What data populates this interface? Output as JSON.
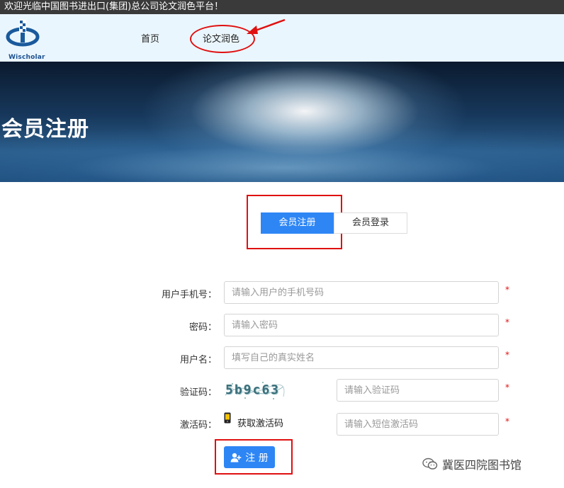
{
  "topbar": {
    "welcome": "欢迎光临中国图书进出口(集团)总公司论文润色平台！"
  },
  "header": {
    "logo_text": "Wischolar",
    "nav": [
      {
        "label": "首页"
      },
      {
        "label": "论文润色"
      }
    ]
  },
  "banner": {
    "title": "会员注册"
  },
  "tabs": {
    "register": "会员注册",
    "login": "会员登录"
  },
  "form": {
    "phone": {
      "label": "用户手机号：",
      "placeholder": "请输入用户的手机号码",
      "required": "*"
    },
    "password": {
      "label": "密码：",
      "placeholder": "请输入密码",
      "required": "*"
    },
    "username": {
      "label": "用户名：",
      "placeholder": "填写自己的真实姓名",
      "required": "*"
    },
    "captcha": {
      "label": "验证码：",
      "image_text": "5b9c63",
      "placeholder": "请输入验证码",
      "required": "*"
    },
    "activation": {
      "label": "激活码：",
      "get_link": "获取激活码",
      "placeholder": "请输入短信激活码",
      "required": "*"
    },
    "submit_label": "注 册"
  },
  "watermark": {
    "text": "冀医四院图书馆",
    "icon": "wechat-icon"
  },
  "colors": {
    "primary": "#2e86f5",
    "annotation": "#e01010",
    "header_bg": "#eaf6fd"
  }
}
